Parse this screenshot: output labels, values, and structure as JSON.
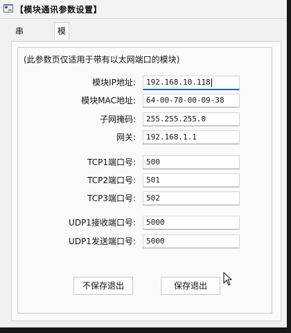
{
  "window": {
    "title": "【模块通讯参数设置】"
  },
  "tabs": [
    {
      "label": "串口参数",
      "active": false
    },
    {
      "label": "模块网络参数",
      "active": true
    }
  ],
  "panel": {
    "note": "(此参数页仅适用于带有以太网端口的模块)"
  },
  "fields": {
    "ip_label": "模块IP地址:",
    "ip_value": "192.168.10.118",
    "mac_label": "模块MAC地址:",
    "mac_value": "64-00-70-00-09-38",
    "subnet_label": "子网掩码:",
    "subnet_value": "255.255.255.0",
    "gateway_label": "网关:",
    "gateway_value": "192.168.1.1",
    "tcp1_label": "TCP1端口号:",
    "tcp1_value": "500",
    "tcp2_label": "TCP2端口号:",
    "tcp2_value": "501",
    "tcp3_label": "TCP3端口号:",
    "tcp3_value": "502",
    "udp_recv_label": "UDP1接收端口号:",
    "udp_recv_value": "5000",
    "udp_send_label": "UDP1发送端口号:",
    "udp_send_value": "5000"
  },
  "buttons": {
    "nosave_exit": "不保存退出",
    "save_exit": "保存退出"
  },
  "icons": {
    "app": "app-icon",
    "cursor": "mouse-pointer-icon"
  }
}
